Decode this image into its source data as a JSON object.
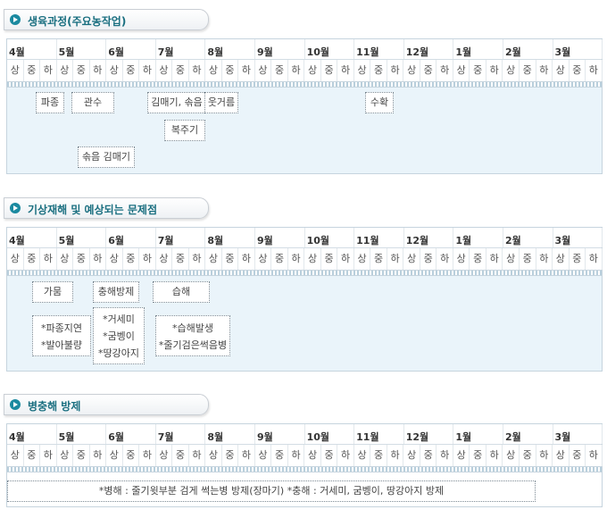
{
  "months": [
    "4월",
    "5월",
    "6월",
    "7월",
    "8월",
    "9월",
    "10월",
    "11월",
    "12월",
    "1월",
    "2월",
    "3월"
  ],
  "periods": [
    "상",
    "중",
    "하"
  ],
  "sections": [
    {
      "title": "생육과정(주요농작업)",
      "boxes": [
        {
          "lines": [
            "파종"
          ]
        },
        {
          "lines": [
            "관수"
          ]
        },
        {
          "lines": [
            "김매기, 솎음"
          ]
        },
        {
          "lines": [
            "웃거름"
          ]
        },
        {
          "lines": [
            "수확"
          ]
        },
        {
          "lines": [
            "복주기"
          ]
        },
        {
          "lines": [
            "솎음 김매기"
          ]
        }
      ]
    },
    {
      "title": "기상재해 및 예상되는 문제점",
      "boxes": [
        {
          "lines": [
            "가뭄"
          ]
        },
        {
          "lines": [
            "충해방제"
          ]
        },
        {
          "lines": [
            "습해"
          ]
        },
        {
          "lines": [
            "*파종지연",
            "*발아불량"
          ]
        },
        {
          "lines": [
            "*거세미",
            "*굼벵이",
            "*땅강아지"
          ]
        },
        {
          "lines": [
            "*습해발생",
            "*줄기검은썩음병"
          ]
        }
      ]
    },
    {
      "title": "병충해 방제",
      "boxes": [
        {
          "lines": [
            "*병해 : 줄기윗부분 검게 썩는병 방제(장마기) *충해 : 거세미, 굼벵이, 땅강아지 방제"
          ]
        }
      ]
    }
  ]
}
